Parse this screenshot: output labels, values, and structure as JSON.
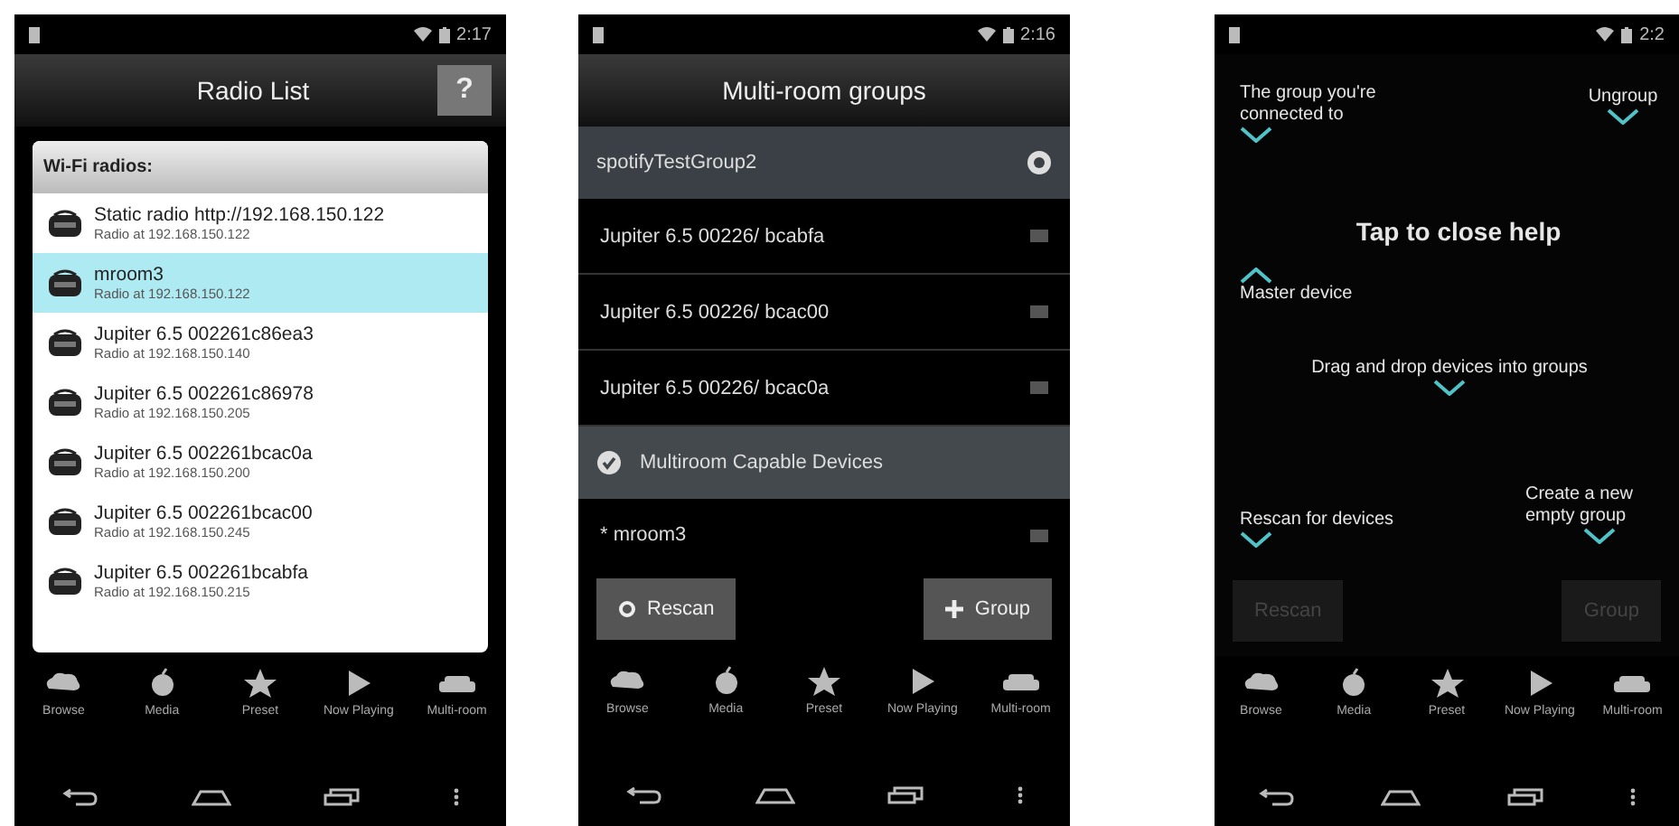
{
  "radio_list_screen": {
    "status_time": "2:17",
    "title": "Radio List",
    "help_button": "?",
    "list_header": "Wi-Fi radios:",
    "radios": [
      {
        "name": "Static radio http://192.168.150.122",
        "address": "Radio at 192.168.150.122",
        "selected": false
      },
      {
        "name": "mroom3",
        "address": "Radio at 192.168.150.122",
        "selected": true
      },
      {
        "name": "Jupiter 6.5 002261c86ea3",
        "address": "Radio at 192.168.150.140",
        "selected": false
      },
      {
        "name": "Jupiter 6.5 002261c86978",
        "address": "Radio at 192.168.150.205",
        "selected": false
      },
      {
        "name": "Jupiter 6.5 002261bcac0a",
        "address": "Radio at 192.168.150.200",
        "selected": false
      },
      {
        "name": "Jupiter 6.5 002261bcac00",
        "address": "Radio at 192.168.150.245",
        "selected": false
      },
      {
        "name": "Jupiter 6.5 002261bcabfa",
        "address": "Radio at 192.168.150.215",
        "selected": false
      }
    ],
    "tabs": [
      "Browse",
      "Media",
      "Preset",
      "Now Playing",
      "Multi-room"
    ]
  },
  "groups_screen": {
    "status_time": "2:16",
    "title": "Multi-room groups",
    "group_name": "spotifyTestGroup2",
    "group_members": [
      "Jupiter 6.5 00226/ bcabfa",
      "Jupiter 6.5 00226/ bcac00",
      "Jupiter 6.5 00226/ bcac0a"
    ],
    "section_header": "Multiroom Capable Devices",
    "ungrouped": [
      "* mroom3"
    ],
    "buttons": [
      "Rescan",
      "Group"
    ],
    "tabs": [
      "Browse",
      "Media",
      "Preset",
      "Now Playing",
      "Multi-room"
    ]
  },
  "help_screen": {
    "status_time": "2:2",
    "hints": [
      {
        "text": "The group you're connected to",
        "kind": "below"
      },
      {
        "text": "Ungroup",
        "kind": "below"
      },
      {
        "text": "Tap to close help",
        "kind": "heading"
      },
      {
        "text": "Master device",
        "kind": "above"
      },
      {
        "text": "Drag and drop devices into groups",
        "kind": "below"
      },
      {
        "text": "Rescan for devices",
        "kind": "below"
      },
      {
        "text": "Create a new empty group",
        "kind": "below"
      }
    ],
    "buttons": [
      "Rescan",
      "Group"
    ],
    "tabs": [
      "Browse",
      "Media",
      "Preset",
      "Now Playing",
      "Multi-room"
    ]
  }
}
